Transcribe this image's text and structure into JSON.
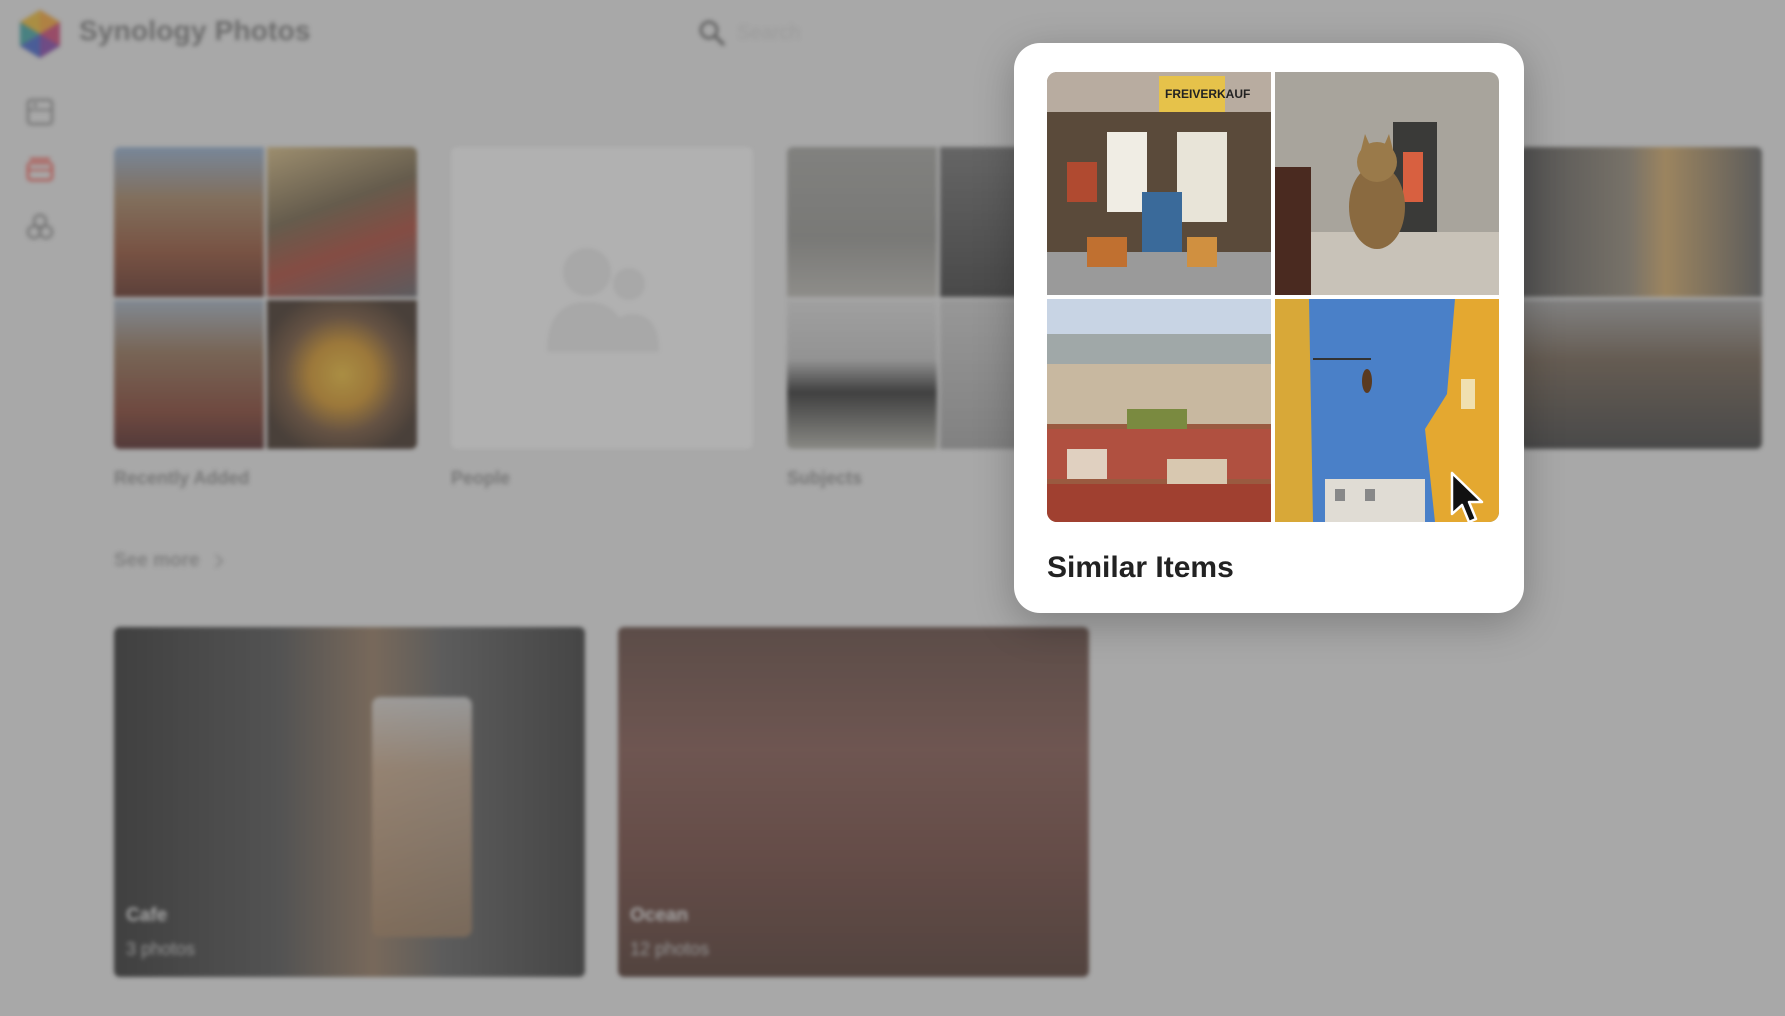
{
  "app": {
    "title": "Synology Photos",
    "search_placeholder": "Search"
  },
  "sidebar": {
    "items": [
      {
        "icon": "photo-library-icon",
        "active": false
      },
      {
        "icon": "albums-icon",
        "active": true
      },
      {
        "icon": "shared-space-icon",
        "active": false
      }
    ]
  },
  "smart_categories": [
    {
      "label": "Recently Added"
    },
    {
      "label": "People"
    },
    {
      "label": "Subjects"
    }
  ],
  "see_more": "See more",
  "albums": [
    {
      "name": "Cafe",
      "count": "3 photos"
    },
    {
      "name": "Ocean",
      "count": "12 photos"
    }
  ],
  "focused_card": {
    "title": "Similar Items",
    "thumbnails": [
      "shop-photo",
      "cat-photo",
      "city-rooftops-photo",
      "yellow-building-sky-photo"
    ]
  },
  "colors": {
    "accent": "#e8524a",
    "overlay": "#5f5f5f",
    "card_bg": "#ffffff"
  }
}
